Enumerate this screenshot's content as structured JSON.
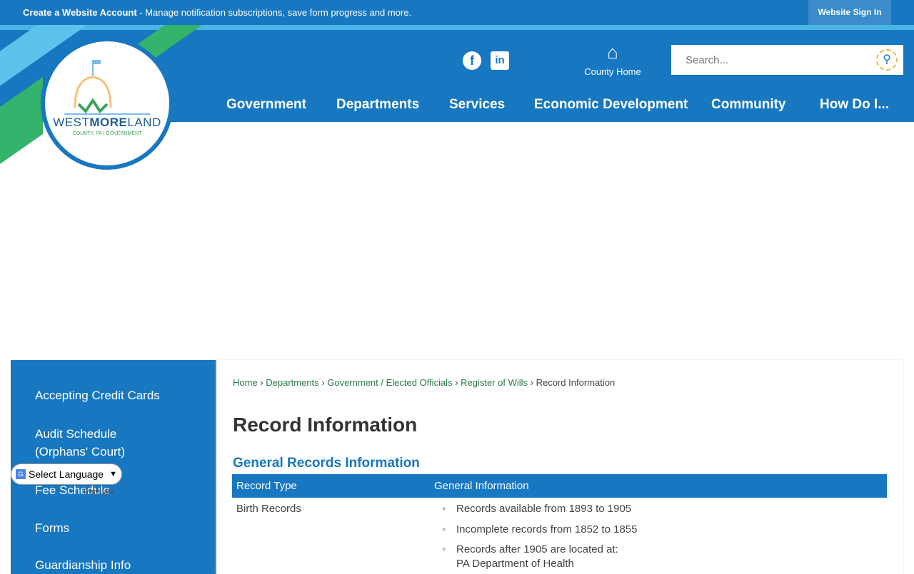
{
  "topbar": {
    "account_bold": "Create a Website Account",
    "account_rest": " - Manage notification subscriptions, save form progress and more.",
    "signin": "Website Sign In"
  },
  "logo": {
    "name_a": "WEST",
    "name_b": "MORE",
    "name_c": "LAND",
    "sub": "COUNTY, PA | GOVERNMENT"
  },
  "header": {
    "county_home": "County Home",
    "search_placeholder": "Search..."
  },
  "nav": [
    "Government",
    "Departments",
    "Services",
    "Economic Development",
    "Community",
    "How Do I..."
  ],
  "sidebar": [
    "Accepting Credit Cards",
    "Audit Schedule",
    "(Orphans' Court)",
    "Fee Schedule",
    "Forms",
    "Guardianship Info"
  ],
  "translate": {
    "select": "Select Language",
    "powered": "Translate"
  },
  "breadcrumb": [
    "Home",
    "Departments",
    "Government / Elected Officials",
    "Register of Wills",
    "Record Information"
  ],
  "page": {
    "title": "Record Information",
    "section": "General Records Information"
  },
  "table": {
    "headers": [
      "Record Type",
      "General Information"
    ],
    "row1": {
      "type": "Birth Records",
      "items": [
        "Records available from 1893 to 1905",
        "Incomplete records from 1852 to 1855",
        "Records after 1905 are located at:",
        "PA Department of Health"
      ]
    }
  }
}
